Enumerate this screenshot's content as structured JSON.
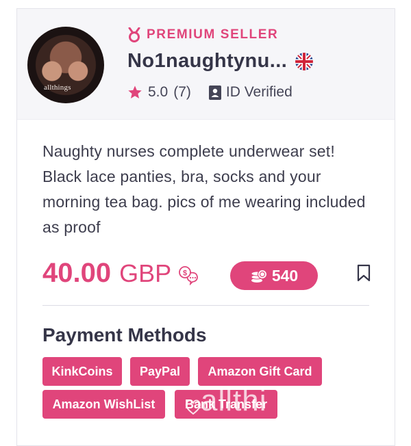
{
  "seller": {
    "badge": "PREMIUM SELLER",
    "name": "No1naughtynu...",
    "rating": "5.0",
    "reviews": "(7)",
    "id_verified": "ID Verified",
    "avatar_watermark": "allthings"
  },
  "listing": {
    "description": "Naughty nurses complete underwear set! Black lace panties, bra, socks and your morning tea bag. pics of me wearing included as proof",
    "price": "40.00",
    "currency": "GBP",
    "coins": "540"
  },
  "payment": {
    "title": "Payment Methods",
    "methods": [
      "KinkCoins",
      "PayPal",
      "Amazon Gift Card",
      "Amazon WishList",
      "Bank Transfer"
    ]
  },
  "watermark": "allthi",
  "colors": {
    "accent": "#e0457b",
    "header_bg": "#f6f6f9",
    "text": "#3d3d50"
  },
  "icons": [
    "medal-icon",
    "uk-flag-icon",
    "star-icon",
    "id-card-icon",
    "currency-convert-icon",
    "coins-icon",
    "bookmark-icon"
  ]
}
